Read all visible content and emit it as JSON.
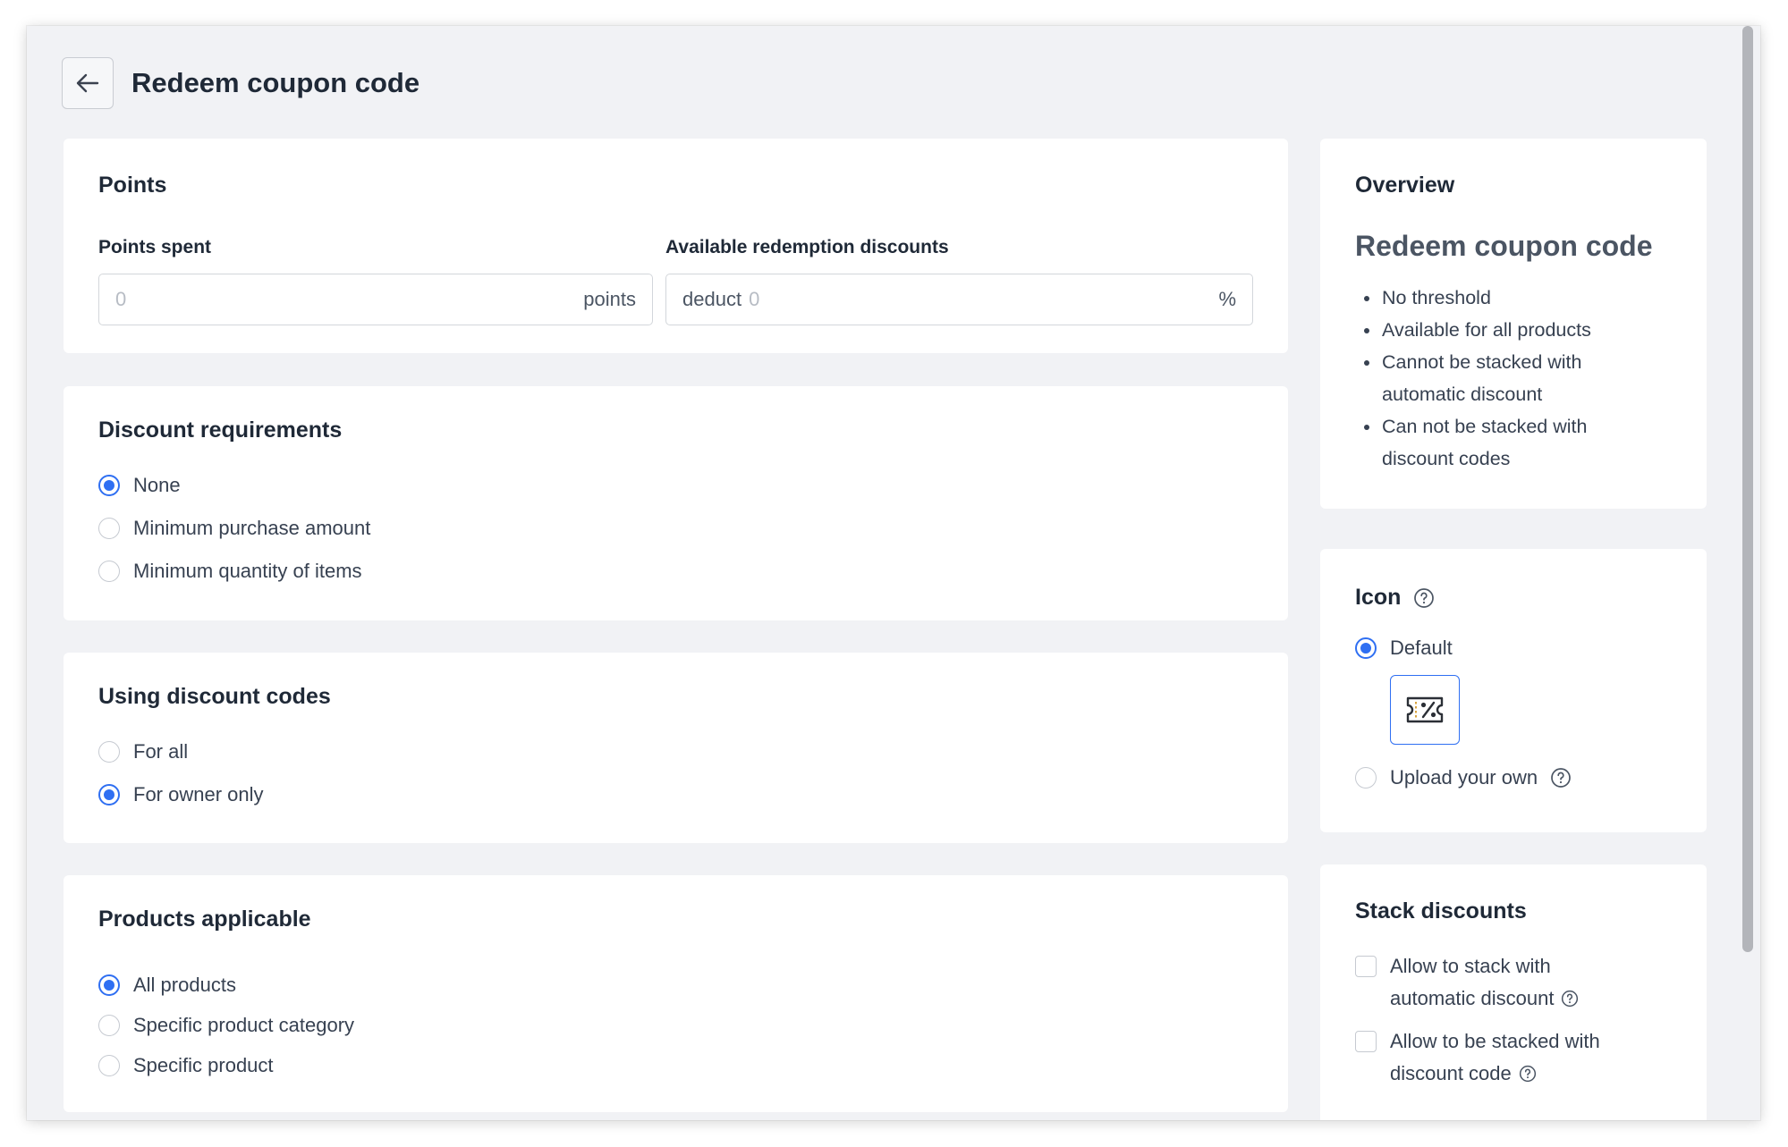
{
  "header": {
    "title": "Redeem coupon code"
  },
  "points": {
    "title": "Points",
    "points_spent": {
      "label": "Points spent",
      "placeholder": "0",
      "suffix": "points"
    },
    "redemption": {
      "label": "Available redemption discounts",
      "prefix": "deduct",
      "placeholder": "0",
      "suffix": "%"
    }
  },
  "discount_requirements": {
    "title": "Discount requirements",
    "options": [
      "None",
      "Minimum purchase amount",
      "Minimum quantity of items"
    ],
    "selected": "None"
  },
  "discount_codes": {
    "title": "Using discount codes",
    "options": [
      "For all",
      "For owner only"
    ],
    "selected": "For owner only"
  },
  "products": {
    "title": "Products applicable",
    "options": [
      "All products",
      "Specific product category",
      "Specific product"
    ],
    "selected": "All products"
  },
  "overview": {
    "title": "Overview",
    "name": "Redeem coupon code",
    "bullets": [
      "No threshold",
      "Available for all products",
      "Cannot be stacked with automatic discount",
      "Can not be stacked with discount codes"
    ]
  },
  "icon": {
    "title": "Icon",
    "default_label": "Default",
    "upload_label": "Upload your own",
    "selected": "Default"
  },
  "stack": {
    "title": "Stack discounts",
    "options": [
      {
        "line1": "Allow to stack with",
        "line2": "automatic discount",
        "checked": false
      },
      {
        "line1": "Allow to be stacked with",
        "line2": "discount code",
        "checked": false
      }
    ]
  },
  "colors": {
    "accent": "#2f6ff2",
    "background": "#f1f2f5",
    "card": "#ffffff"
  }
}
